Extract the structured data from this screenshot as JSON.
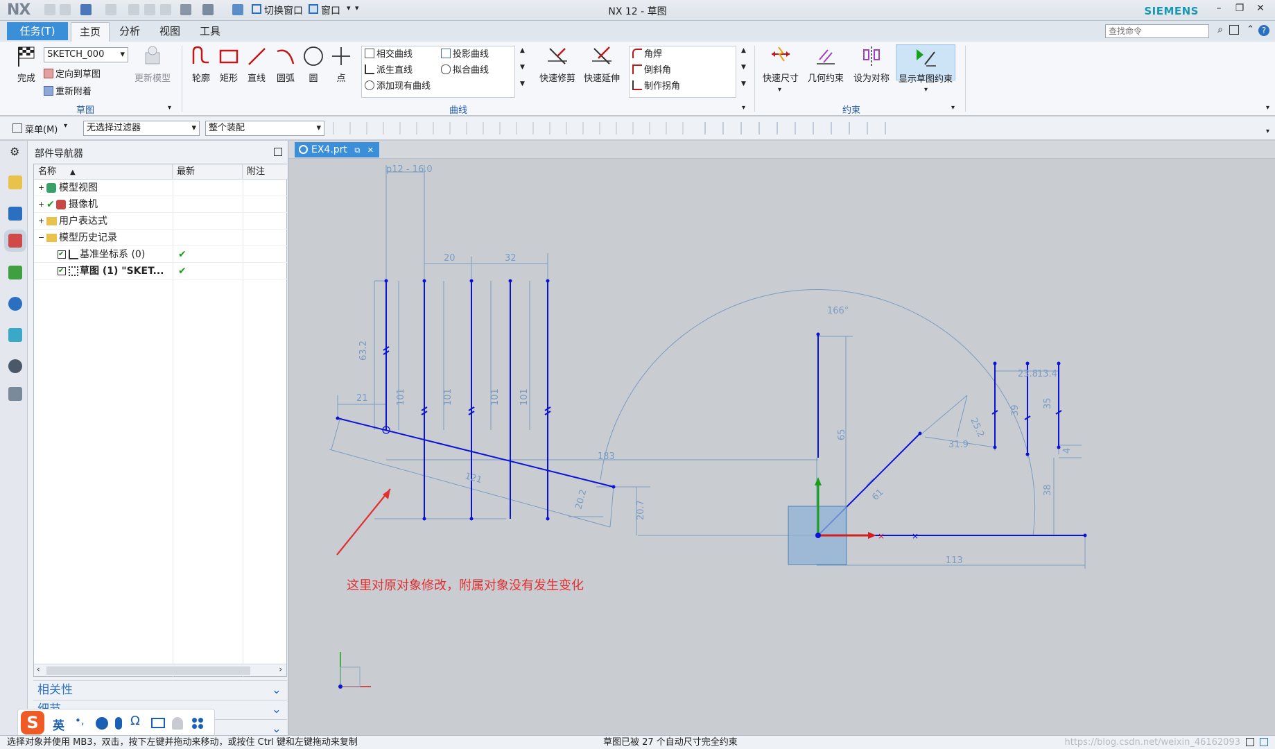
{
  "app": {
    "logo": "NX",
    "title": "NX 12 - 草图",
    "brand": "SIEMENS",
    "quick_switch": "切换窗口",
    "window_menu": "窗口"
  },
  "menu": {
    "task": "任务(T)",
    "tabs": [
      "主页",
      "分析",
      "视图",
      "工具"
    ],
    "search_placeholder": "查找命令"
  },
  "ribbon": {
    "finish": "完成",
    "sketch_name": "SKETCH_000",
    "orient": "定向到草图",
    "reattach": "重新附着",
    "update_model": "更新模型",
    "group_sketch": "草图",
    "curves": [
      "轮廓",
      "矩形",
      "直线",
      "圆弧",
      "圆",
      "点"
    ],
    "curve_small": [
      "相交曲线",
      "派生直线",
      "添加现有曲线",
      "投影曲线",
      "拟合曲线"
    ],
    "trim": "快速修剪",
    "extend": "快速延伸",
    "corner": [
      "角焊",
      "倒斜角",
      "制作拐角"
    ],
    "group_curve": "曲线",
    "rapid_dim": "快速尺寸",
    "geo_constraint": "几何约束",
    "symmetric": "设为对称",
    "show_constraints": "显示草图约束",
    "group_constraint": "约束"
  },
  "toolbar2": {
    "menu": "菜单(M)",
    "filter": "无选择过滤器",
    "assembly": "整个装配"
  },
  "navigator": {
    "title": "部件导航器",
    "columns": [
      "名称",
      "最新",
      "附注"
    ],
    "rows": [
      {
        "label": "模型视图",
        "check": ""
      },
      {
        "label": "摄像机",
        "check": ""
      },
      {
        "label": "用户表达式",
        "check": ""
      },
      {
        "label": "模型历史记录",
        "check": ""
      },
      {
        "label": "基准坐标系 (0)",
        "check": "✔"
      },
      {
        "label": "草图 (1) \"SKET...",
        "check": "✔"
      }
    ],
    "sections": [
      "相关性",
      "细节",
      ""
    ]
  },
  "ime": {
    "lang": "英"
  },
  "document": {
    "tab": "EX4.prt"
  },
  "sketch": {
    "dims": [
      "p12 - 16.0",
      "20",
      "32",
      "63.2",
      "101",
      "101",
      "101",
      "101",
      "21",
      "121",
      "20.2",
      "20.7",
      "183",
      "166°",
      "65",
      "61",
      "25.2",
      "31.9",
      "39",
      "23.8",
      "13.4",
      "35",
      "38",
      "4",
      "113"
    ],
    "annotation": "这里对原对象修改，附属对象没有发生变化"
  },
  "status": {
    "left": "选择对象并使用 MB3，双击，按下左键并拖动来移动，或按住 Ctrl 键和左键拖动来复制",
    "center": "草图已被 27 个自动尺寸完全约束",
    "watermark": "https://blog.csdn.net/weixin_46162093"
  },
  "colors": {
    "sketch_line": "#0a12d6",
    "dimension": "#7a9cc4",
    "annotation": "#e03030",
    "accent": "#3a8fd8"
  }
}
